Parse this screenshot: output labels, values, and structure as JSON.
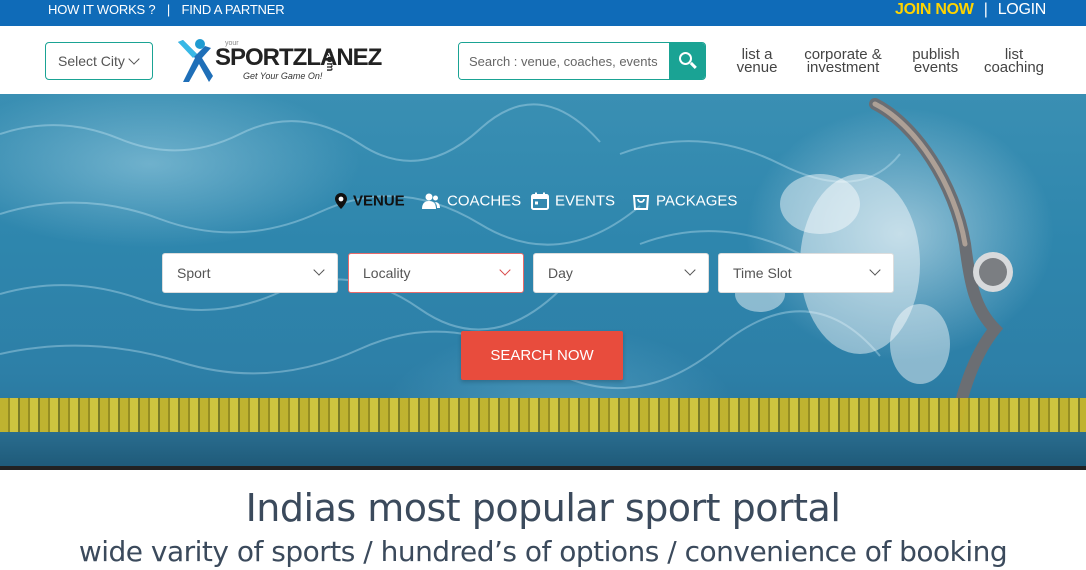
{
  "topbar": {
    "how_it_works": "HOW IT WORKS ?",
    "separator": "|",
    "find_partner": "FIND A PARTNER",
    "join_now": "JOIN NOW",
    "login_sep": "|",
    "login": "LOGIN"
  },
  "header": {
    "city_select": "Select City",
    "logo": {
      "your": "your",
      "word": "SPORTZLANEZ",
      "com": ".com",
      "tagline": "Get Your Game On!"
    },
    "search_placeholder": "Search : venue, coaches, events",
    "nav": [
      {
        "line1": "list a",
        "line2": "venue"
      },
      {
        "line1": "corporate &",
        "line2": "investment"
      },
      {
        "line1": "publish",
        "line2": "events"
      },
      {
        "line1": "list",
        "line2": "coaching"
      }
    ]
  },
  "hero": {
    "tabs": [
      {
        "label": "VENUE",
        "icon": "map-pin-icon",
        "active": true
      },
      {
        "label": "COACHES",
        "icon": "users-icon",
        "active": false
      },
      {
        "label": "EVENTS",
        "icon": "calendar-icon",
        "active": false
      },
      {
        "label": "PACKAGES",
        "icon": "bag-icon",
        "active": false
      }
    ],
    "filters": [
      {
        "label": "Sport"
      },
      {
        "label": "Locality"
      },
      {
        "label": "Day"
      },
      {
        "label": "Time Slot"
      }
    ],
    "search_button": "SEARCH NOW"
  },
  "tagline": {
    "heading": "Indias most popular sport portal",
    "subheading": "wide varity of sports / hundred’s of options / convenience of booking"
  },
  "colors": {
    "topbar": "#0f6bb8",
    "accent": "#1aa394",
    "join": "#ffd400",
    "cta": "#e84c3d"
  }
}
